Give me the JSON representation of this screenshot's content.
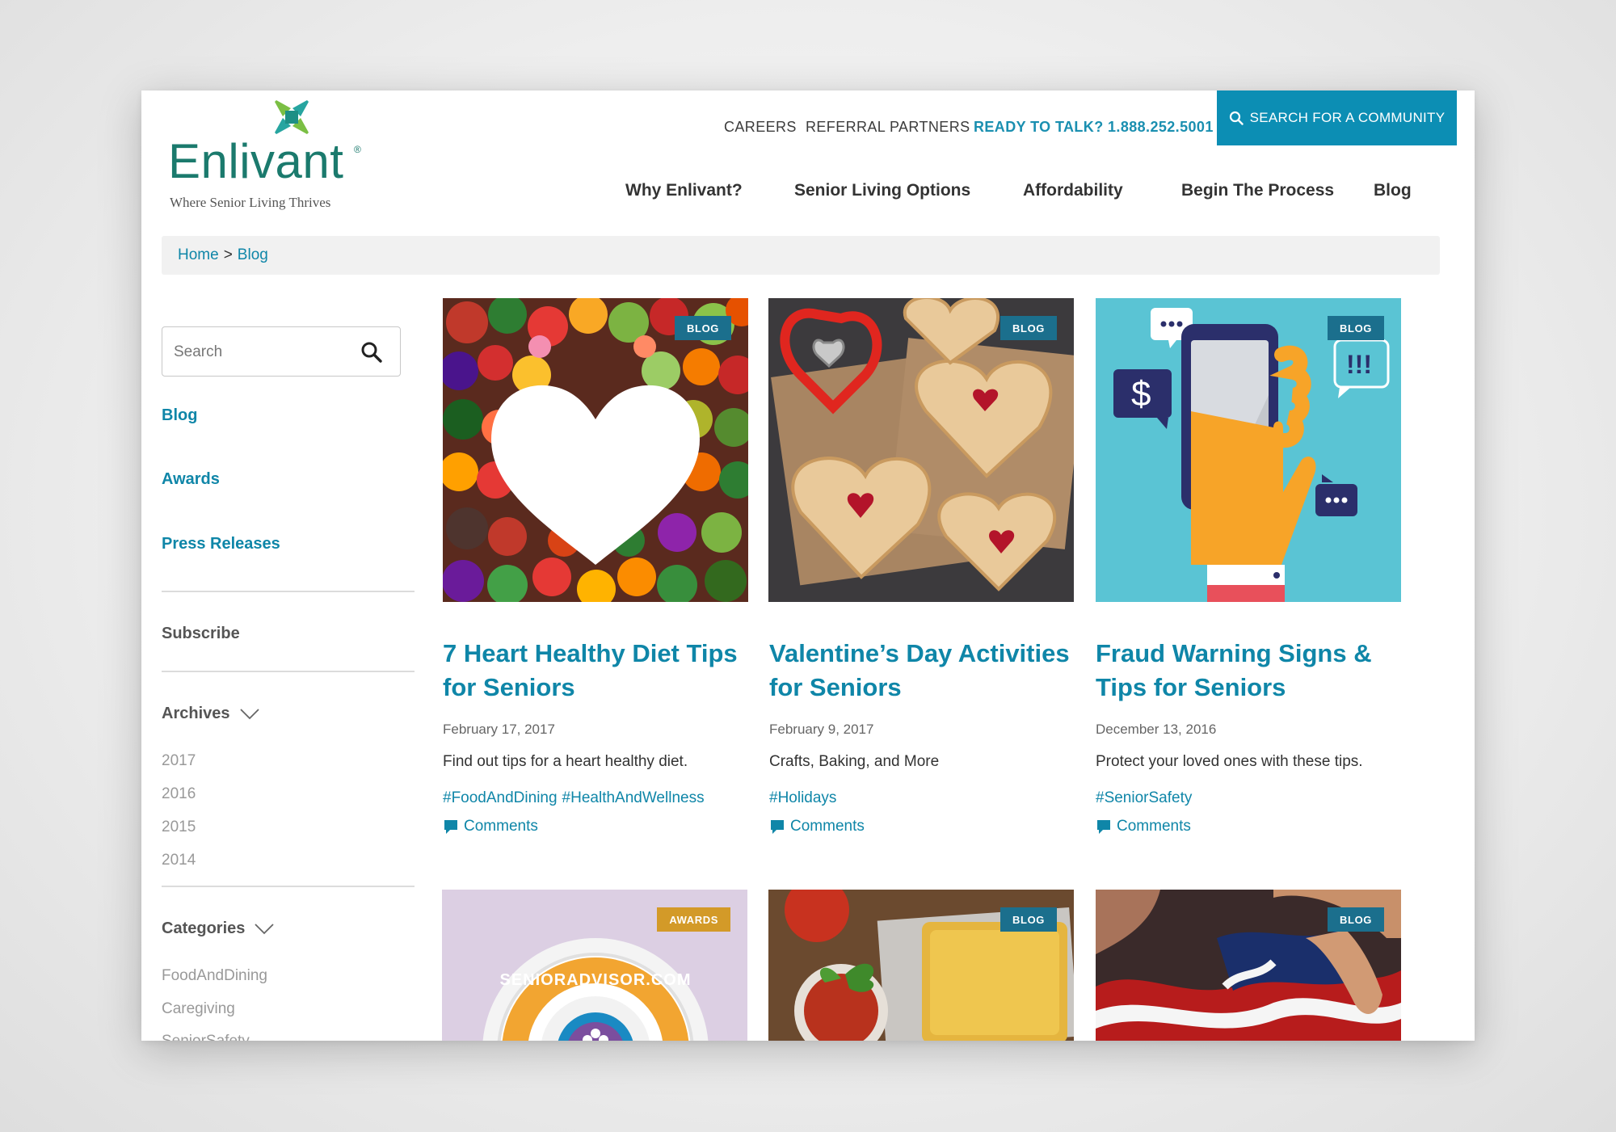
{
  "brand": {
    "name": "Enlivant",
    "trademark": "®",
    "tagline": "Where Senior Living Thrives"
  },
  "utility_nav": {
    "careers": "CAREERS",
    "referral": "REFERRAL PARTNERS",
    "phone": "READY TO TALK? 1.888.252.5001",
    "search_community": "SEARCH FOR A COMMUNITY"
  },
  "main_nav": {
    "items": [
      "Why Enlivant?",
      "Senior Living Options",
      "Affordability",
      "Begin The Process",
      "Blog"
    ]
  },
  "breadcrumb": {
    "home": "Home",
    "separator": ">",
    "current": "Blog"
  },
  "sidebar": {
    "search_placeholder": "Search",
    "links": [
      "Blog",
      "Awards",
      "Press Releases"
    ],
    "subscribe": "Subscribe",
    "archives_label": "Archives",
    "archives": [
      "2017",
      "2016",
      "2015",
      "2014"
    ],
    "categories_label": "Categories",
    "categories": [
      "FoodAndDining",
      "Caregiving",
      "SeniorSafety"
    ]
  },
  "posts": [
    {
      "badge": "BLOG",
      "title": "7 Heart Healthy Diet Tips for Seniors",
      "date": "February 17, 2017",
      "description": "Find out tips for a heart healthy diet.",
      "tags": [
        "#FoodAndDining",
        "#HealthAndWellness"
      ],
      "comments": "Comments",
      "image": "vegetable-heart-image"
    },
    {
      "badge": "BLOG",
      "title": "Valentine’s Day Activities for Seniors",
      "date": "February 9, 2017",
      "description": "Crafts, Baking, and More",
      "tags": [
        "#Holidays"
      ],
      "comments": "Comments",
      "image": "heart-pies-image"
    },
    {
      "badge": "BLOG",
      "title": "Fraud Warning Signs & Tips for Seniors",
      "date": "December 13, 2016",
      "description": "Protect your loved ones with these tips.",
      "tags": [
        "#SeniorSafety"
      ],
      "comments": "Comments",
      "image": "phone-fraud-illustration"
    }
  ],
  "lower_posts": [
    {
      "badge": "AWARDS",
      "image": "senioradvisor-badge-image",
      "image_text": "SENIORADVISOR.COM"
    },
    {
      "badge": "BLOG",
      "image": "pasta-tomato-image"
    },
    {
      "badge": "BLOG",
      "image": "flag-hands-image"
    }
  ],
  "colors": {
    "accent": "#0f86a8",
    "search_button": "#0c8eb4",
    "badge_blog": "#1b6f8d",
    "badge_awards": "#d39a28",
    "logo_green": "#1b7a6d"
  }
}
